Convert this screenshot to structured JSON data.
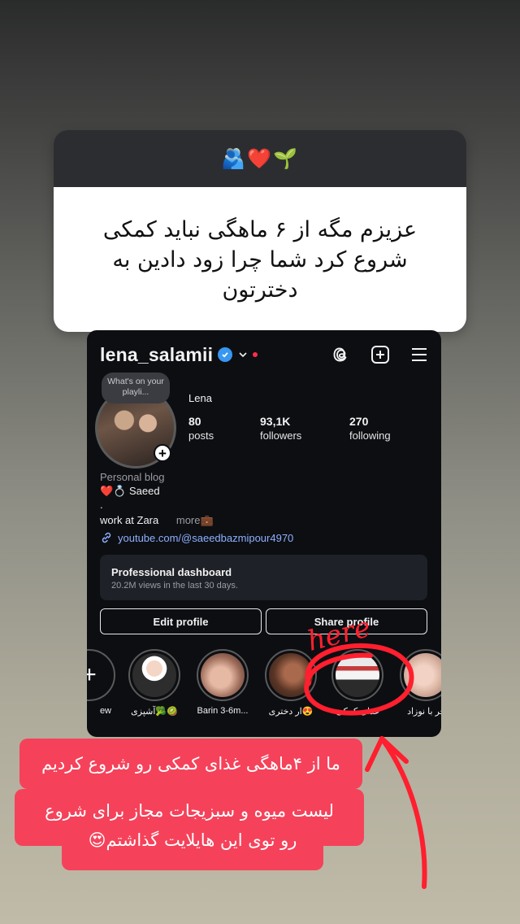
{
  "question": {
    "emojis": "🫂❤️🌱",
    "text": "عزیزم مگه از ۶ ماهگی نباید کمکی شروع کرد شما چرا زود دادین به دخترتون"
  },
  "profile": {
    "username": "lena_salamii",
    "note": "What's on your playli...",
    "display_name": "Lena",
    "stats": [
      {
        "value": "80",
        "label": "posts"
      },
      {
        "value": "93,1K",
        "label": "followers"
      },
      {
        "value": "270",
        "label": "following"
      }
    ],
    "bio": {
      "category": "Personal blog",
      "line1": "❤️💍 Saeed",
      "line2": ".",
      "line3": "work at Zara",
      "more": "more💼"
    },
    "link": "youtube.com/@saeedbazmipour4970",
    "dashboard": {
      "title": "Professional dashboard",
      "subtitle": "20.2M views in the last 30 days."
    },
    "buttons": {
      "edit": "Edit profile",
      "share": "Share profile"
    },
    "highlights": [
      {
        "label": "ew"
      },
      {
        "label": "🥝🥦آشپزی"
      },
      {
        "label": "Barin 3-6m..."
      },
      {
        "label": "😍ار دختری"
      },
      {
        "label": "غذای کمکی"
      },
      {
        "label": "فر با نوزاد"
      }
    ]
  },
  "annotations": {
    "here": "here",
    "caption_line1": "ما از ۴ماهگی غذای کمکی رو شروع کردیم",
    "caption_line2": "لیست میوه و سبزیجات مجاز برای شروع",
    "caption_line3": "رو توی این هایلایت گذاشتم😍",
    "accent_color": "#f5425a"
  }
}
